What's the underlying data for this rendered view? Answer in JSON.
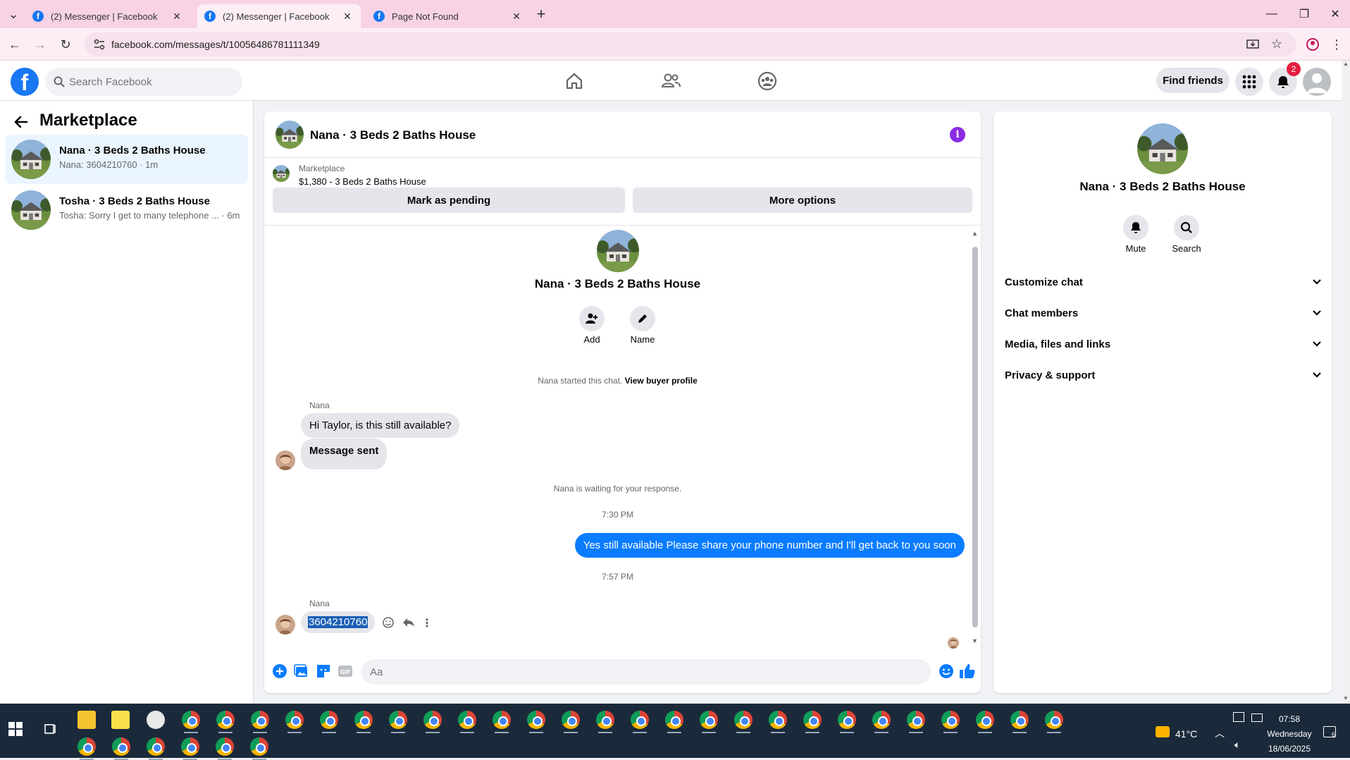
{
  "browser": {
    "tabs": [
      {
        "title": "(2) Messenger | Facebook",
        "active": false
      },
      {
        "title": "(2) Messenger | Facebook",
        "active": true
      },
      {
        "title": "Page Not Found",
        "active": false
      }
    ],
    "url": "facebook.com/messages/t/10056486781111349"
  },
  "fb_header": {
    "search_placeholder": "Search Facebook",
    "find_friends": "Find friends",
    "notification_count": "2"
  },
  "sidebar": {
    "title": "Marketplace",
    "conversations": [
      {
        "name": "Nana · 3 Beds 2 Baths House",
        "preview": "Nana: 3604210760 · 1m",
        "active": true
      },
      {
        "name": "Tosha · 3 Beds 2 Baths House",
        "preview": "Tosha: Sorry I get to many telephone ... · 6m",
        "active": false
      }
    ]
  },
  "chat": {
    "title": "Nana · 3 Beds 2 Baths House",
    "listing_label": "Marketplace",
    "listing_price": "$1,380 - 3 Beds 2 Baths House",
    "mark_pending": "Mark as pending",
    "more_options": "More options",
    "conversation_name": "Nana · 3 Beds 2 Baths House",
    "add_label": "Add",
    "name_label": "Name",
    "started_text": "Nana started this chat.",
    "view_buyer": "View buyer profile",
    "messages": [
      {
        "sender": "Nana",
        "text": "Hi Taylor, is this still available?"
      },
      {
        "text": "Message sent"
      }
    ],
    "waiting_text": "Nana is waiting for your response.",
    "time1": "7:30 PM",
    "outgoing": "Yes still available Please share your phone number and I'll get back to you soon",
    "time2": "7:57 PM",
    "last_sender": "Nana",
    "last_message": "3604210760",
    "composer_placeholder": "Aa"
  },
  "right_panel": {
    "name": "Nana · 3 Beds 2 Baths House",
    "mute": "Mute",
    "search": "Search",
    "sections": [
      "Customize chat",
      "Chat members",
      "Media, files and links",
      "Privacy & support"
    ]
  },
  "taskbar": {
    "temperature": "41°C",
    "time": "07:58",
    "day": "Wednesday",
    "date": "18/06/2025",
    "tray_count": "6"
  },
  "colors": {
    "fb_blue": "#1877f2",
    "messenger_blue": "#0a7cff",
    "tab_pink": "#f8d3e6",
    "info_purple": "#8a2be2"
  }
}
